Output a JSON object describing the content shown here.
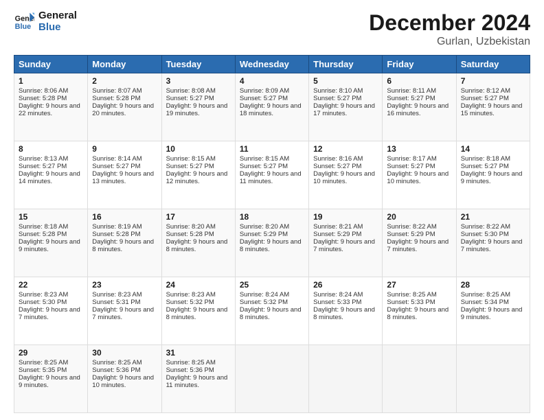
{
  "logo": {
    "line1": "General",
    "line2": "Blue"
  },
  "title": "December 2024",
  "subtitle": "Gurlan, Uzbekistan",
  "weekdays": [
    "Sunday",
    "Monday",
    "Tuesday",
    "Wednesday",
    "Thursday",
    "Friday",
    "Saturday"
  ],
  "weeks": [
    [
      {
        "day": "1",
        "sunrise": "8:06 AM",
        "sunset": "5:28 PM",
        "daylight": "9 hours and 22 minutes."
      },
      {
        "day": "2",
        "sunrise": "8:07 AM",
        "sunset": "5:28 PM",
        "daylight": "9 hours and 20 minutes."
      },
      {
        "day": "3",
        "sunrise": "8:08 AM",
        "sunset": "5:27 PM",
        "daylight": "9 hours and 19 minutes."
      },
      {
        "day": "4",
        "sunrise": "8:09 AM",
        "sunset": "5:27 PM",
        "daylight": "9 hours and 18 minutes."
      },
      {
        "day": "5",
        "sunrise": "8:10 AM",
        "sunset": "5:27 PM",
        "daylight": "9 hours and 17 minutes."
      },
      {
        "day": "6",
        "sunrise": "8:11 AM",
        "sunset": "5:27 PM",
        "daylight": "9 hours and 16 minutes."
      },
      {
        "day": "7",
        "sunrise": "8:12 AM",
        "sunset": "5:27 PM",
        "daylight": "9 hours and 15 minutes."
      }
    ],
    [
      {
        "day": "8",
        "sunrise": "8:13 AM",
        "sunset": "5:27 PM",
        "daylight": "9 hours and 14 minutes."
      },
      {
        "day": "9",
        "sunrise": "8:14 AM",
        "sunset": "5:27 PM",
        "daylight": "9 hours and 13 minutes."
      },
      {
        "day": "10",
        "sunrise": "8:15 AM",
        "sunset": "5:27 PM",
        "daylight": "9 hours and 12 minutes."
      },
      {
        "day": "11",
        "sunrise": "8:15 AM",
        "sunset": "5:27 PM",
        "daylight": "9 hours and 11 minutes."
      },
      {
        "day": "12",
        "sunrise": "8:16 AM",
        "sunset": "5:27 PM",
        "daylight": "9 hours and 10 minutes."
      },
      {
        "day": "13",
        "sunrise": "8:17 AM",
        "sunset": "5:27 PM",
        "daylight": "9 hours and 10 minutes."
      },
      {
        "day": "14",
        "sunrise": "8:18 AM",
        "sunset": "5:27 PM",
        "daylight": "9 hours and 9 minutes."
      }
    ],
    [
      {
        "day": "15",
        "sunrise": "8:18 AM",
        "sunset": "5:28 PM",
        "daylight": "9 hours and 9 minutes."
      },
      {
        "day": "16",
        "sunrise": "8:19 AM",
        "sunset": "5:28 PM",
        "daylight": "9 hours and 8 minutes."
      },
      {
        "day": "17",
        "sunrise": "8:20 AM",
        "sunset": "5:28 PM",
        "daylight": "9 hours and 8 minutes."
      },
      {
        "day": "18",
        "sunrise": "8:20 AM",
        "sunset": "5:29 PM",
        "daylight": "9 hours and 8 minutes."
      },
      {
        "day": "19",
        "sunrise": "8:21 AM",
        "sunset": "5:29 PM",
        "daylight": "9 hours and 7 minutes."
      },
      {
        "day": "20",
        "sunrise": "8:22 AM",
        "sunset": "5:29 PM",
        "daylight": "9 hours and 7 minutes."
      },
      {
        "day": "21",
        "sunrise": "8:22 AM",
        "sunset": "5:30 PM",
        "daylight": "9 hours and 7 minutes."
      }
    ],
    [
      {
        "day": "22",
        "sunrise": "8:23 AM",
        "sunset": "5:30 PM",
        "daylight": "9 hours and 7 minutes."
      },
      {
        "day": "23",
        "sunrise": "8:23 AM",
        "sunset": "5:31 PM",
        "daylight": "9 hours and 7 minutes."
      },
      {
        "day": "24",
        "sunrise": "8:23 AM",
        "sunset": "5:32 PM",
        "daylight": "9 hours and 8 minutes."
      },
      {
        "day": "25",
        "sunrise": "8:24 AM",
        "sunset": "5:32 PM",
        "daylight": "9 hours and 8 minutes."
      },
      {
        "day": "26",
        "sunrise": "8:24 AM",
        "sunset": "5:33 PM",
        "daylight": "9 hours and 8 minutes."
      },
      {
        "day": "27",
        "sunrise": "8:25 AM",
        "sunset": "5:33 PM",
        "daylight": "9 hours and 8 minutes."
      },
      {
        "day": "28",
        "sunrise": "8:25 AM",
        "sunset": "5:34 PM",
        "daylight": "9 hours and 9 minutes."
      }
    ],
    [
      {
        "day": "29",
        "sunrise": "8:25 AM",
        "sunset": "5:35 PM",
        "daylight": "9 hours and 9 minutes."
      },
      {
        "day": "30",
        "sunrise": "8:25 AM",
        "sunset": "5:36 PM",
        "daylight": "9 hours and 10 minutes."
      },
      {
        "day": "31",
        "sunrise": "8:25 AM",
        "sunset": "5:36 PM",
        "daylight": "9 hours and 11 minutes."
      },
      null,
      null,
      null,
      null
    ]
  ]
}
